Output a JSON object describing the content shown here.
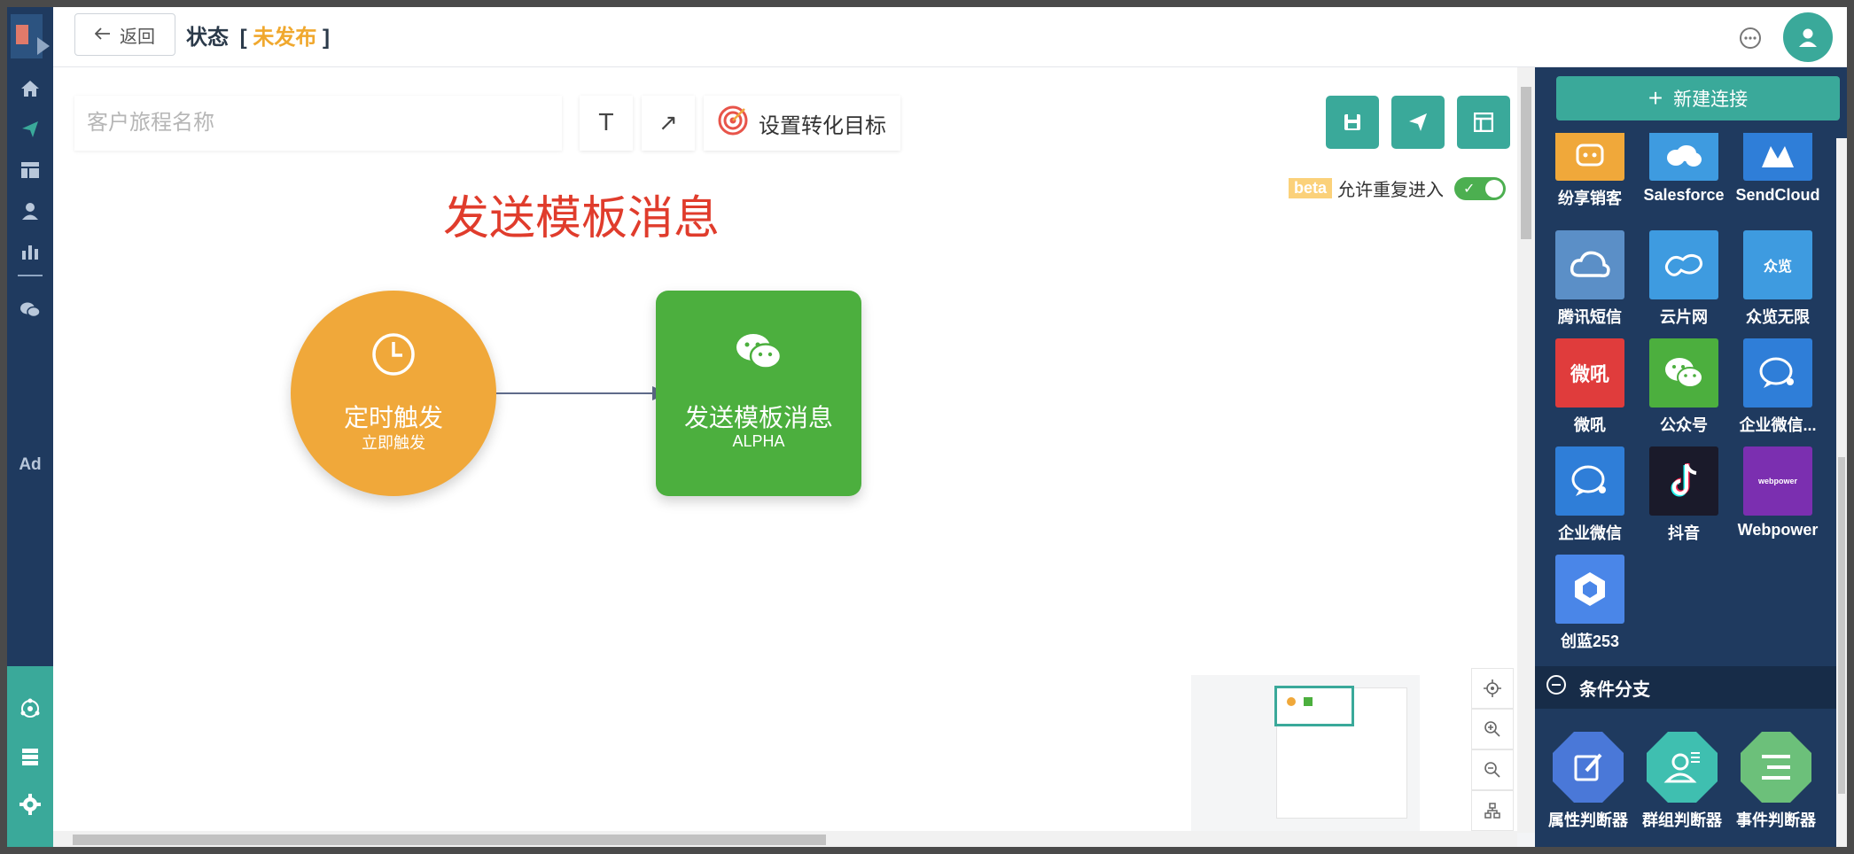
{
  "header": {
    "back_label": "返回",
    "status_label": "状态",
    "status_value": "未发布"
  },
  "toolbar": {
    "name_placeholder": "客户旅程名称",
    "text_tool": "T",
    "arrow_tool": "↗",
    "goal_label": "设置转化目标"
  },
  "beta": {
    "badge": "beta",
    "label": "允许重复进入",
    "enabled": true
  },
  "canvas": {
    "title": "发送模板消息",
    "nodes": [
      {
        "title": "定时触发",
        "subtitle": "立即触发",
        "icon": "clock-icon",
        "color": "#f0a83a"
      },
      {
        "title": "发送模板消息",
        "subtitle": "ALPHA",
        "icon": "wechat-icon",
        "color": "#4caf3e"
      }
    ]
  },
  "panel": {
    "new_connection": "新建连接",
    "apps": [
      {
        "label": "纷享销客",
        "icon": "fxiaoke-icon",
        "color": "#f0a83a"
      },
      {
        "label": "Salesforce",
        "icon": "salesforce-icon",
        "color": "#3e9be0"
      },
      {
        "label": "SendCloud",
        "icon": "sendcloud-icon",
        "color": "#2f7ed8"
      },
      {
        "label": "腾讯短信",
        "icon": "tencent-cloud-icon",
        "color": "#5b8fc7"
      },
      {
        "label": "云片网",
        "icon": "yunpian-icon",
        "color": "#3e9be0"
      },
      {
        "label": "众览无限",
        "icon": "zhonglan-icon",
        "color": "#3e9be0"
      },
      {
        "label": "微吼",
        "icon": "vhall-icon",
        "color": "#e03c3c"
      },
      {
        "label": "公众号",
        "icon": "wechat-icon",
        "color": "#4caf3e"
      },
      {
        "label": "企业微信...",
        "icon": "wecom-icon",
        "color": "#2f7ed8"
      },
      {
        "label": "企业微信",
        "icon": "wecom-icon",
        "color": "#2f7ed8"
      },
      {
        "label": "抖音",
        "icon": "douyin-icon",
        "color": "#1a1a2a"
      },
      {
        "label": "Webpower",
        "icon": "webpower-icon",
        "color": "#7b2fb0"
      },
      {
        "label": "创蓝253",
        "icon": "chuanglan-icon",
        "color": "#4a86e8"
      }
    ],
    "tile_texts": {
      "vhall": "微吼",
      "zhonglan": "众览",
      "webpower": "webpower"
    },
    "section": {
      "label": "条件分支",
      "items": [
        {
          "label": "属性判断器",
          "icon": "edit-icon",
          "color": "#4a78d8"
        },
        {
          "label": "群组判断器",
          "icon": "group-user-icon",
          "color": "#3fbfb0"
        },
        {
          "label": "事件判断器",
          "icon": "list-icon",
          "color": "#6cc07a"
        }
      ]
    }
  }
}
